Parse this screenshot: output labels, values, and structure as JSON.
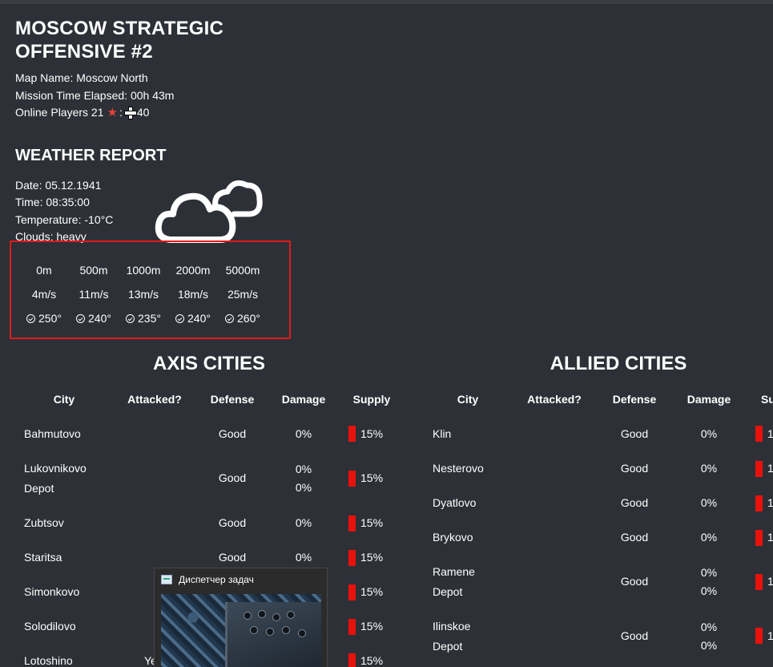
{
  "mission": {
    "title": "MOSCOW STRATEGIC OFFENSIVE #2",
    "map_name": "Map Name: Moscow North",
    "time_elapsed": "Mission Time Elapsed: 00h 43m",
    "online_prefix": "Online Players 21",
    "online_sep": ":",
    "online_axis_count": "40"
  },
  "weather": {
    "heading": "WEATHER REPORT",
    "date": "Date: 05.12.1941",
    "time": "Time: 08:35:00",
    "temperature": "Temperature: -10°C",
    "clouds": "Clouds: heavy",
    "icon": "cloud-icon",
    "altitudes": [
      "0m",
      "500m",
      "1000m",
      "2000m",
      "5000m"
    ],
    "speeds": [
      "4m/s",
      "11m/s",
      "13m/s",
      "18m/s",
      "25m/s"
    ],
    "directions": [
      "250°",
      "240°",
      "235°",
      "240°",
      "260°"
    ]
  },
  "axis": {
    "heading": "AXIS CITIES",
    "columns": [
      "City",
      "Attacked?",
      "Defense",
      "Damage",
      "Supply"
    ],
    "rows": [
      {
        "city": "Bahmutovo",
        "defense": "Good",
        "damage": "0%",
        "supply": "15%"
      },
      {
        "city": "Lukovnikovo",
        "sub": "Depot",
        "defense": "Good",
        "damage": "0%",
        "damage2": "0%",
        "supply": "15%"
      },
      {
        "city": "Zubtsov",
        "defense": "Good",
        "damage": "0%",
        "supply": "15%"
      },
      {
        "city": "Staritsa",
        "defense": "Good",
        "damage": "0%",
        "supply": "15%"
      },
      {
        "city": "Simonkovo",
        "supply": "15%"
      },
      {
        "city": "Solodilovo",
        "supply": "15%"
      },
      {
        "city": "Lotoshino",
        "attacked": "Ye",
        "supply": "15%"
      }
    ]
  },
  "allied": {
    "heading": "ALLIED CITIES",
    "columns": [
      "City",
      "Attacked?",
      "Defense",
      "Damage",
      "Su"
    ],
    "rows": [
      {
        "city": "Klin",
        "defense": "Good",
        "damage": "0%",
        "supply": "1"
      },
      {
        "city": "Nesterovo",
        "defense": "Good",
        "damage": "0%",
        "supply": "1"
      },
      {
        "city": "Dyatlovo",
        "defense": "Good",
        "damage": "0%",
        "supply": "1"
      },
      {
        "city": "Brykovo",
        "defense": "Good",
        "damage": "0%",
        "supply": "1"
      },
      {
        "city": "Ramene",
        "sub": "Depot",
        "defense": "Good",
        "damage": "0%",
        "damage2": "0%",
        "supply": "1"
      },
      {
        "city": "Ilinskoe",
        "sub": "Depot",
        "defense": "Good",
        "damage": "0%",
        "damage2": "0%",
        "supply": "1"
      }
    ]
  },
  "taskbar_preview": {
    "title": "Диспетчер задач"
  },
  "colors": {
    "background": "#2d3036",
    "supply_bar": "#e8120c",
    "highlight_box": "#e01b1b"
  }
}
